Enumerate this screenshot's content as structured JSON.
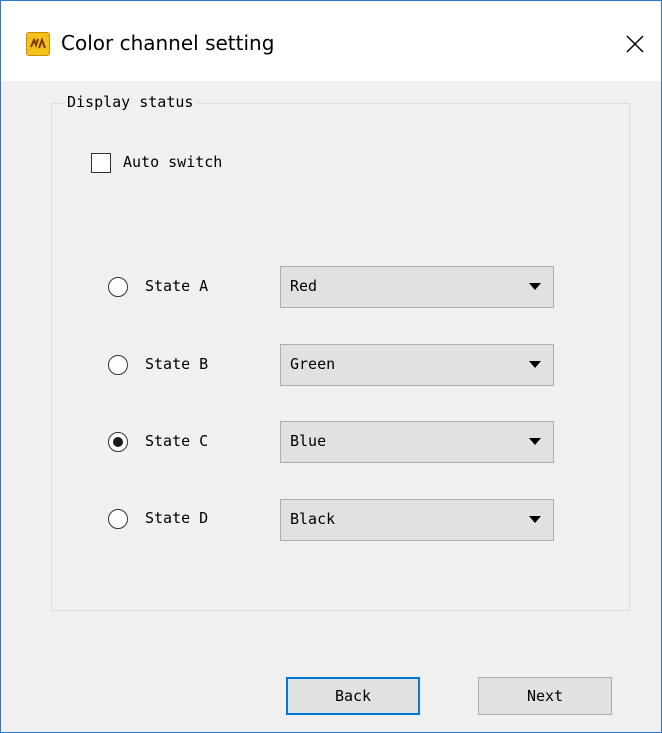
{
  "window": {
    "title": "Color channel setting",
    "app_icon": "app-logo-icon",
    "close_icon": "close-icon",
    "border_color": "#2f78c8"
  },
  "groupbox": {
    "label": "Display status"
  },
  "auto_switch": {
    "label": "Auto switch",
    "checked": false
  },
  "states": [
    {
      "label": "State A",
      "selected": false,
      "value": "Red"
    },
    {
      "label": "State B",
      "selected": false,
      "value": "Green"
    },
    {
      "label": "State C",
      "selected": true,
      "value": "Blue"
    },
    {
      "label": "State D",
      "selected": false,
      "value": "Black"
    }
  ],
  "buttons": {
    "back_label": "Back",
    "next_label": "Next",
    "accent": "#0078d7"
  }
}
